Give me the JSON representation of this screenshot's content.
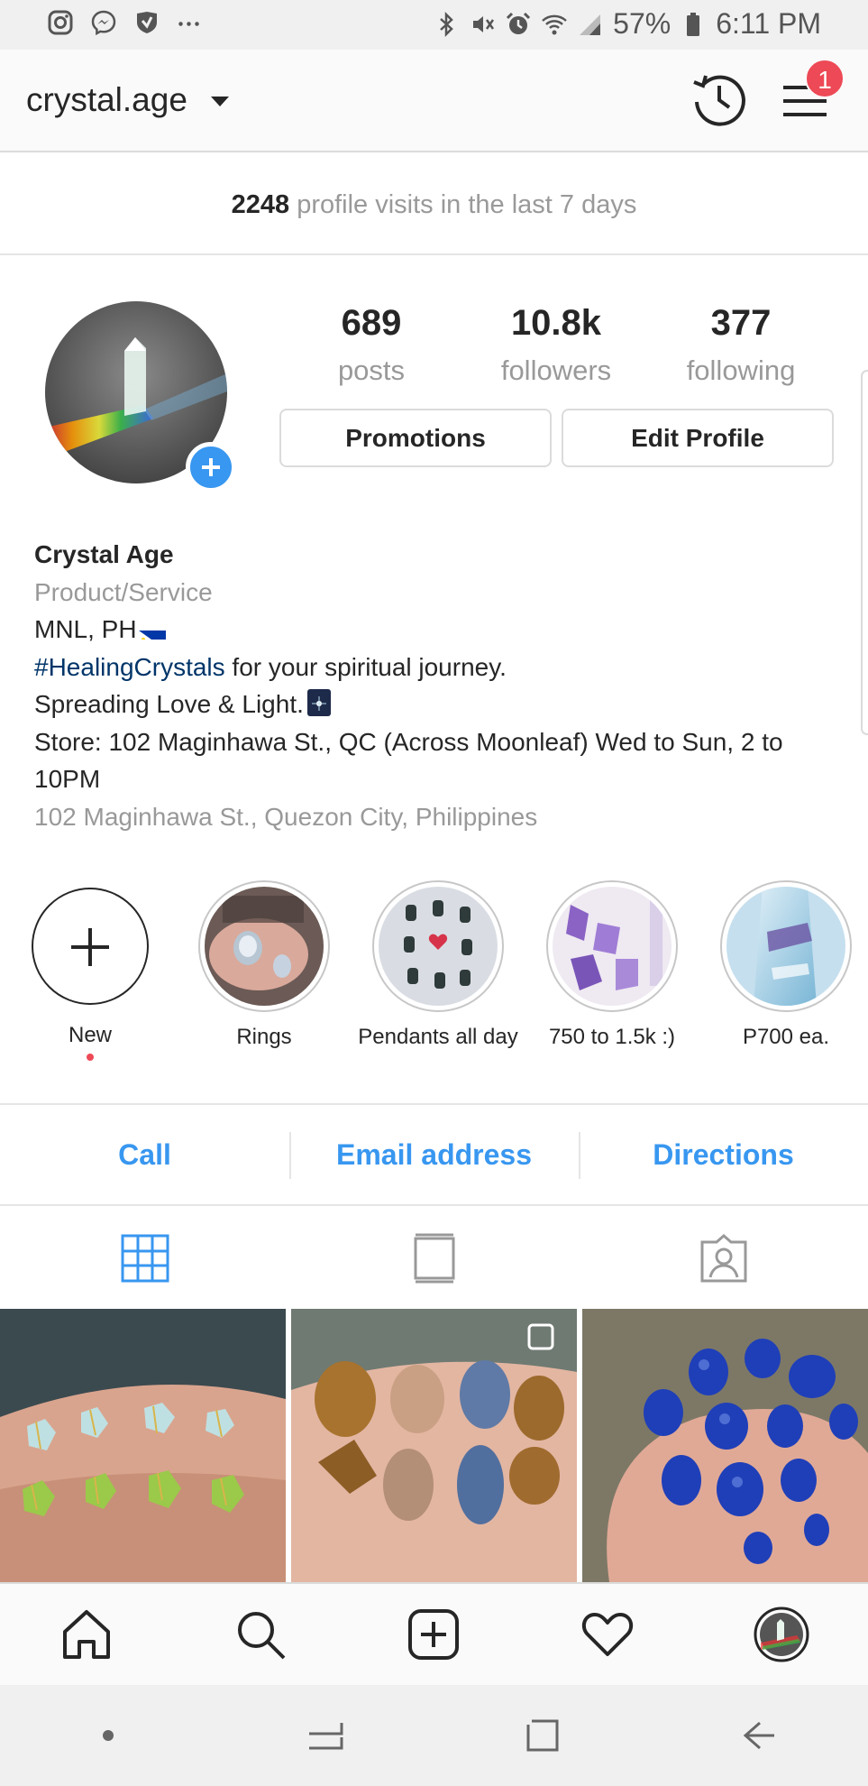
{
  "status_bar": {
    "battery_pct": "57%",
    "time": "6:11 PM",
    "left_icons": [
      "instagram-icon",
      "messenger-icon",
      "vpn-shield-icon",
      "more-dots-icon"
    ],
    "right_icons": [
      "bluetooth-icon",
      "mute-icon",
      "alarm-icon",
      "wifi-icon",
      "signal-icon",
      "battery-icon"
    ]
  },
  "header": {
    "username": "crystal.age",
    "notification_count": "1"
  },
  "insights": {
    "visits_count": "2248",
    "visits_text": " profile visits in the last 7 days"
  },
  "profile": {
    "stats": [
      {
        "value": "689",
        "label": "posts"
      },
      {
        "value": "10.8k",
        "label": "followers"
      },
      {
        "value": "377",
        "label": "following"
      }
    ],
    "buttons": {
      "promotions": "Promotions",
      "edit": "Edit Profile"
    }
  },
  "bio": {
    "name": "Crystal Age",
    "category": "Product/Service",
    "location": "MNL, PH",
    "hashtag": "#HealingCrystals",
    "line2_rest": " for your spiritual journey.",
    "line3": "Spreading Love & Light.",
    "line4": "Store: 102 Maginhawa St., QC (Across Moonleaf) Wed to Sun, 2 to 10PM",
    "address": "102 Maginhawa St., Quezon City, Philippines"
  },
  "highlights": [
    {
      "label": "New"
    },
    {
      "label": "Rings"
    },
    {
      "label": "Pendants all day"
    },
    {
      "label": "750 to 1.5k :)"
    },
    {
      "label": "P700 ea."
    }
  ],
  "actions": {
    "call": "Call",
    "email": "Email address",
    "directions": "Directions"
  },
  "tabs": [
    "grid-tab",
    "feed-tab",
    "tagged-tab"
  ],
  "colors": {
    "accent_blue": "#3897f0",
    "badge_red": "#ed4956",
    "hashtag": "#003569",
    "muted_text": "#999999"
  }
}
